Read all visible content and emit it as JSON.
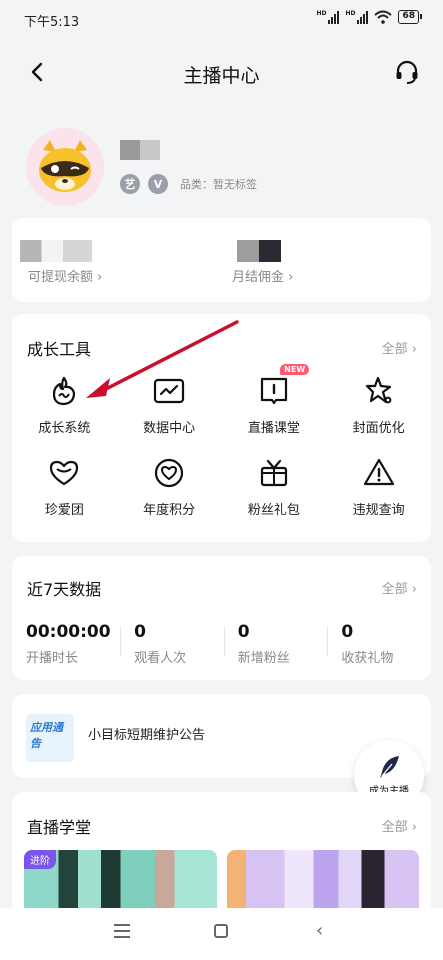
{
  "status_bar": {
    "time": "下午5:13",
    "battery": "68"
  },
  "nav": {
    "title": "主播中心"
  },
  "profile": {
    "badge_1": "艺",
    "badge_2": "V",
    "category": "品类：暂无标签"
  },
  "balance": {
    "withdrawable_label": "可提现余额",
    "monthly_commission_label": "月结佣金"
  },
  "growth_tools": {
    "title": "成长工具",
    "all_label": "全部",
    "new_badge": "NEW",
    "items": [
      {
        "label": "成长系统",
        "icon": "flame-icon"
      },
      {
        "label": "数据中心",
        "icon": "chart-icon"
      },
      {
        "label": "直播课堂",
        "icon": "book-icon"
      },
      {
        "label": "封面优化",
        "icon": "sparkle-icon"
      },
      {
        "label": "珍爱团",
        "icon": "heart-icon"
      },
      {
        "label": "年度积分",
        "icon": "heart-circle-icon"
      },
      {
        "label": "粉丝礼包",
        "icon": "gift-icon"
      },
      {
        "label": "违规查询",
        "icon": "warning-icon"
      }
    ]
  },
  "recent_data": {
    "title": "近7天数据",
    "all_label": "全部",
    "stats": [
      {
        "value": "00:00:00",
        "label": "开播时长"
      },
      {
        "value": "0",
        "label": "观看人次"
      },
      {
        "value": "0",
        "label": "新增粉丝"
      },
      {
        "value": "0",
        "label": "收获礼物"
      }
    ]
  },
  "notice": {
    "image_text": "应用通告",
    "text": "小目标短期维护公告"
  },
  "fab": {
    "label": "成为主播"
  },
  "live_school": {
    "title": "直播学堂",
    "all_label": "全部",
    "tag": "进阶"
  },
  "colors": {
    "accent_red": "#ff5a6e",
    "arrow_red": "#c8102e",
    "tag_purple": "#7a55e8"
  }
}
